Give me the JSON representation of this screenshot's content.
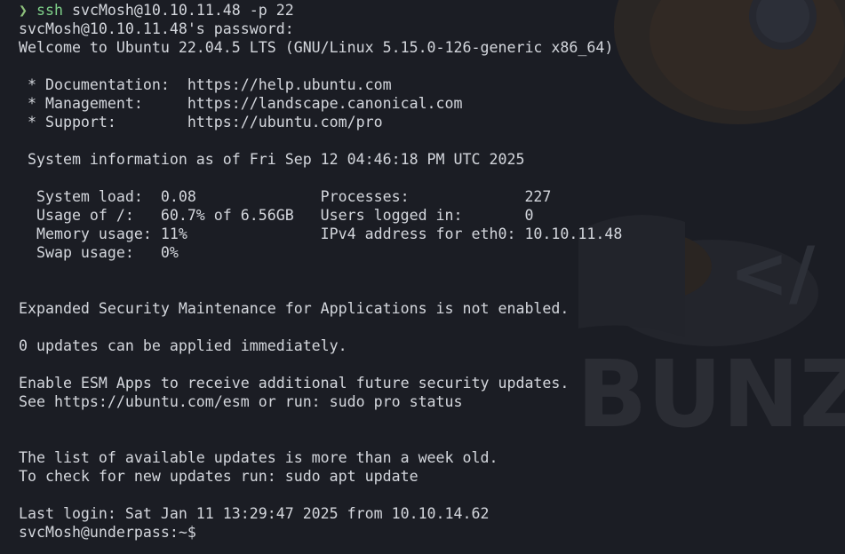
{
  "terminal": {
    "command": {
      "arrow": "❯",
      "program": "ssh",
      "args": " svcMosh@10.10.11.48 -p 22"
    },
    "lines": [
      "svcMosh@10.10.11.48's password:",
      "Welcome to Ubuntu 22.04.5 LTS (GNU/Linux 5.15.0-126-generic x86_64)",
      "",
      " * Documentation:  https://help.ubuntu.com",
      " * Management:     https://landscape.canonical.com",
      " * Support:        https://ubuntu.com/pro",
      "",
      " System information as of Fri Sep 12 04:46:18 PM UTC 2025",
      "",
      "  System load:  0.08              Processes:             227",
      "  Usage of /:   60.7% of 6.56GB   Users logged in:       0",
      "  Memory usage: 11%               IPv4 address for eth0: 10.10.11.48",
      "  Swap usage:   0%",
      "",
      "",
      "Expanded Security Maintenance for Applications is not enabled.",
      "",
      "0 updates can be applied immediately.",
      "",
      "Enable ESM Apps to receive additional future security updates.",
      "See https://ubuntu.com/esm or run: sudo pro status",
      "",
      "",
      "The list of available updates is more than a week old.",
      "To check for new updates run: sudo apt update",
      "",
      "Last login: Sat Jan 11 13:29:47 2025 from 10.10.14.62"
    ],
    "final_prompt": "svcMosh@underpass:~$"
  },
  "wallpaper": {
    "text": "BUNZ",
    "symbol": "</",
    "colors": {
      "background": "#1b1d24",
      "text": "#d4d7dd",
      "accent_green": "#7fd18a",
      "wallpaper_mark": "#2a2c33",
      "wallpaper_orange": "#3a2a24"
    }
  }
}
